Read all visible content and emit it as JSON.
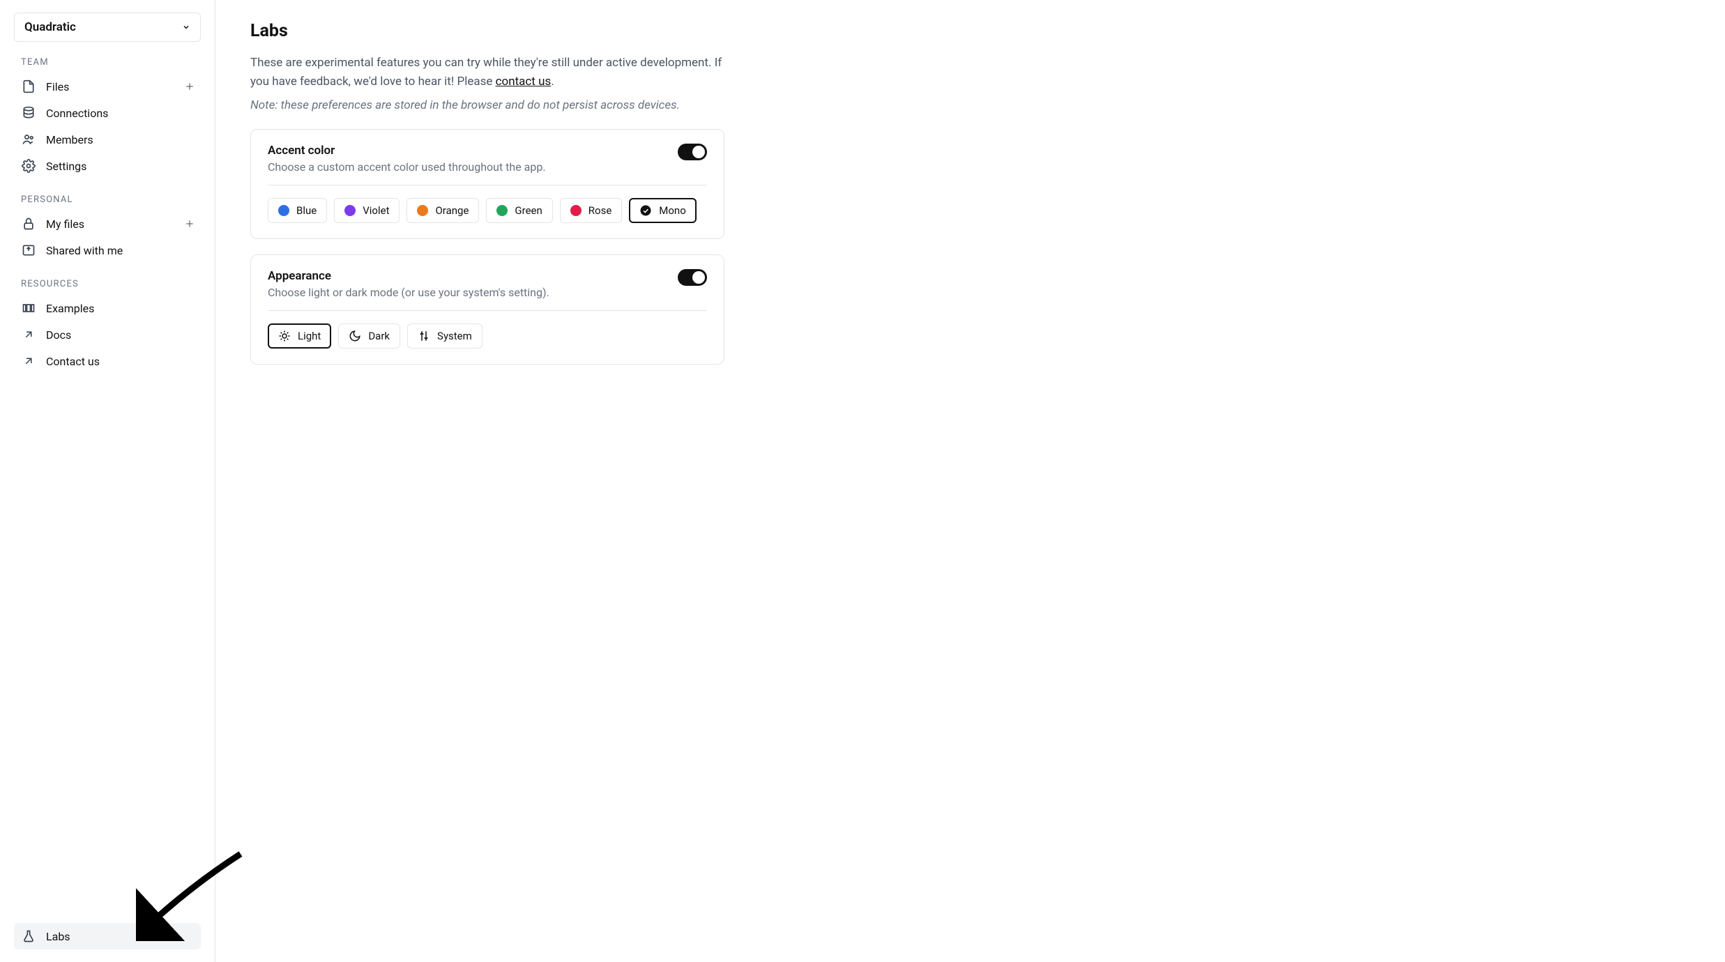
{
  "brand": {
    "name": "Quadratic"
  },
  "sidebar": {
    "sections": {
      "team": {
        "label": "TEAM",
        "items": [
          {
            "label": "Files",
            "icon": "file-icon",
            "plus": true
          },
          {
            "label": "Connections",
            "icon": "database-icon"
          },
          {
            "label": "Members",
            "icon": "people-icon"
          },
          {
            "label": "Settings",
            "icon": "gear-icon"
          }
        ]
      },
      "personal": {
        "label": "PERSONAL",
        "items": [
          {
            "label": "My files",
            "icon": "lock-icon",
            "plus": true
          },
          {
            "label": "Shared with me",
            "icon": "inbox-icon"
          }
        ]
      },
      "resources": {
        "label": "RESOURCES",
        "items": [
          {
            "label": "Examples",
            "icon": "layout-icon"
          },
          {
            "label": "Docs",
            "icon": "external-link-icon"
          },
          {
            "label": "Contact us",
            "icon": "external-link-icon"
          }
        ]
      }
    },
    "footer": {
      "labs_label": "Labs"
    }
  },
  "page": {
    "title": "Labs",
    "description_1": "These are experimental features you can try while they're still under active development. If you have feedback, we'd love to hear it! Please ",
    "contact_link": "contact us",
    "description_2": ".",
    "note": "Note: these preferences are stored in the browser and do not persist across devices."
  },
  "accent": {
    "title": "Accent color",
    "subtitle": "Choose a custom accent color used throughout the app.",
    "enabled": true,
    "selected": "Mono",
    "options": [
      {
        "label": "Blue",
        "color": "#2f6fe4"
      },
      {
        "label": "Violet",
        "color": "#7c3aed"
      },
      {
        "label": "Orange",
        "color": "#ea7a1f"
      },
      {
        "label": "Green",
        "color": "#22a55b"
      },
      {
        "label": "Rose",
        "color": "#e11d48"
      },
      {
        "label": "Mono",
        "color": "#111111"
      }
    ]
  },
  "appearance": {
    "title": "Appearance",
    "subtitle": "Choose light or dark mode (or use your system's setting).",
    "enabled": true,
    "selected": "Light",
    "options": [
      {
        "label": "Light",
        "icon": "sun-icon"
      },
      {
        "label": "Dark",
        "icon": "moon-icon"
      },
      {
        "label": "System",
        "icon": "sliders-icon"
      }
    ]
  }
}
